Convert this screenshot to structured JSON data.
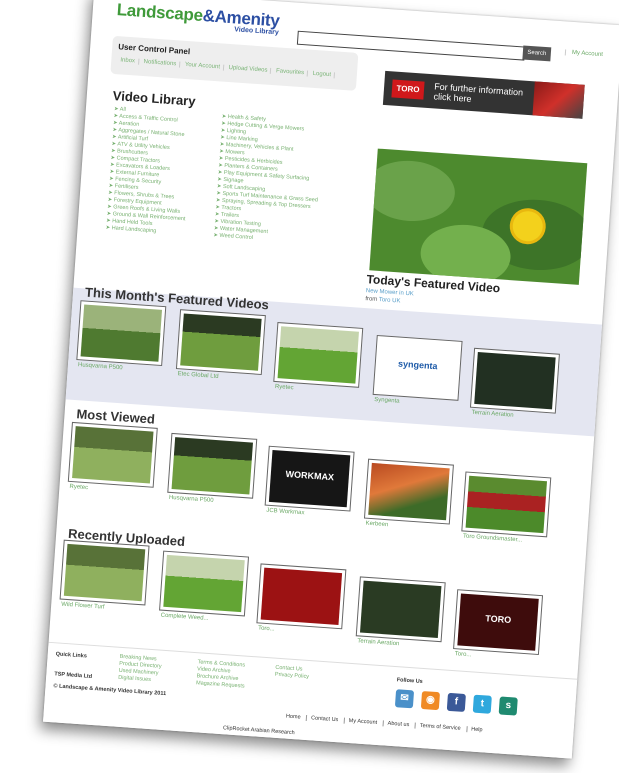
{
  "header": {
    "logo_main": "Landscape",
    "logo_amp": "&Amenity",
    "logo_sub": "Video Library",
    "search_button": "Search",
    "my_account": "My Account"
  },
  "user_control_panel": {
    "title": "User Control Panel",
    "links": [
      "Inbox",
      "Notifications",
      "Your Account",
      "Upload Videos",
      "Favourites",
      "Logout"
    ]
  },
  "banner": {
    "brand": "TORO",
    "text_line1": "For further information",
    "text_line2": "click here"
  },
  "video_library": {
    "title": "Video Library",
    "categories_left": [
      "All",
      "Access & Traffic Control",
      "Aeration",
      "Aggregates / Natural Stone",
      "Artificial Turf",
      "ATV & Utility Vehicles",
      "Brushcutters",
      "Compact Tractors",
      "Excavators & Loaders",
      "External Furniture",
      "Fencing & Security",
      "Fertilisers",
      "Flowers, Shrubs & Trees",
      "Forestry Equipment",
      "Green Roofs & Living Walls",
      "Ground & Wall Reinforcement",
      "Hand Held Tools",
      "Hard Landscaping"
    ],
    "categories_right": [
      "Health & Safety",
      "Hedge Cutting & Verge Mowers",
      "Lighting",
      "Line Marking",
      "Machinery, Vehicles & Plant",
      "Mowers",
      "Pesticides & Herbicides",
      "Planters & Containers",
      "Play Equipment & Safety Surfacing",
      "Signage",
      "Soft Landscaping",
      "Sports Turf Maintenance & Grass Seed",
      "Spraying, Spreading & Top Dressers",
      "Tractors",
      "Trailers",
      "Vibration Testing",
      "Water Management",
      "Weed Control"
    ]
  },
  "featured_video": {
    "heading": "Today's Featured Video",
    "title": "New Mower in UK",
    "from_label": "from",
    "from_name": "Toro UK"
  },
  "sections": [
    {
      "title": "This Month's Featured Videos",
      "items": [
        "Husqvarna P500",
        "Etec Global Ltd",
        "Ryetec",
        "Syngenta",
        "Terrain Aeration"
      ]
    },
    {
      "title": "Most Viewed",
      "items": [
        "Ryetec",
        "Husqvarna P500",
        "JCB Workmax",
        "Kerbeen",
        "Toro Groundsmaster..."
      ]
    },
    {
      "title": "Recently Uploaded",
      "items": [
        "Wild Flower Turf",
        "Complete Weed...",
        "Toro...",
        "Terrain Aeration",
        "Toro..."
      ]
    }
  ],
  "thumb_labels": {
    "syngenta": "syngenta",
    "workmax": "WORKMAX",
    "toro": "TORO",
    "groundsbreaker": "GROUNDSBREAKER"
  },
  "footer": {
    "quick_links": "Quick Links",
    "company": "TSP Media Ltd",
    "copyright": "© Landscape & Amenity Video Library 2011",
    "col2": [
      "Breaking News",
      "Product Directory",
      "Used Machinery",
      "Digital Issues"
    ],
    "col3": [
      "Terms & Conditions",
      "Video Archive",
      "Brochure Archive",
      "Magazine Requests"
    ],
    "col4": [
      "Contact Us",
      "Privacy Policy"
    ],
    "follow_us": "Follow Us",
    "bottom_links": [
      "Home",
      "Contact Us",
      "My Account",
      "About us",
      "Terms of Service",
      "Help"
    ],
    "credit": "ClipRocket  Arabian Research"
  }
}
